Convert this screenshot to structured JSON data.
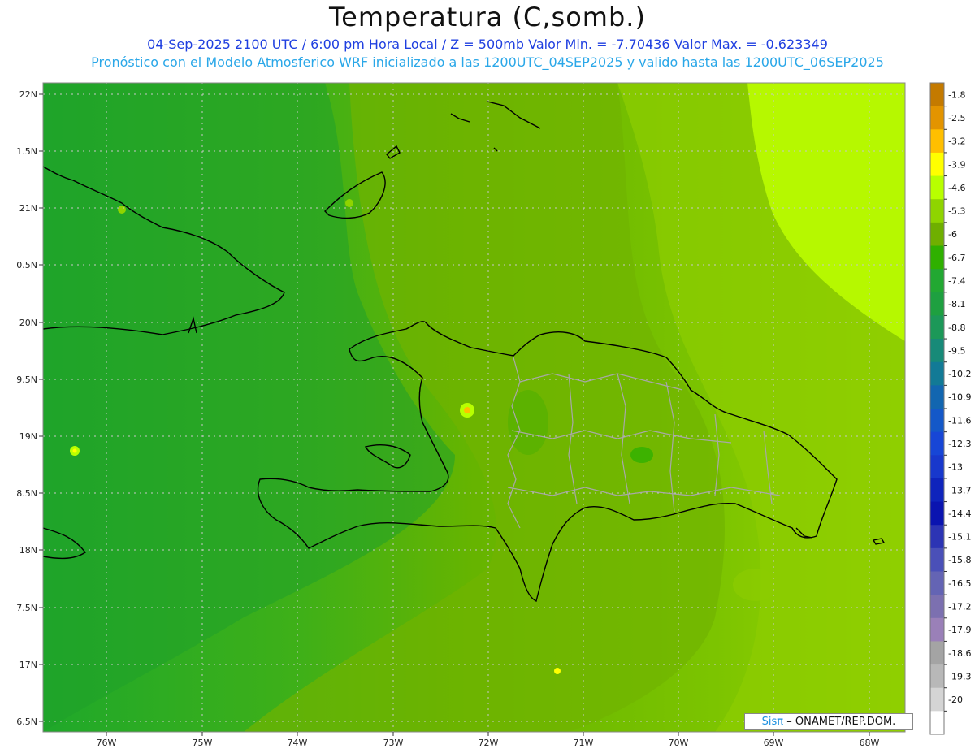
{
  "header": {
    "title": "Temperatura (C,somb.)",
    "subtitle1": "04-Sep-2025  2100 UTC / 6:00 pm Hora Local / Z = 500mb  Valor Min. = -7.70436  Valor Max. = -0.623349",
    "subtitle2": "Pronóstico con el Modelo Atmosferico WRF inicializado a las 1200UTC_04SEP2025 y valido hasta las  1200UTC_06SEP2025"
  },
  "axes": {
    "lat_labels": [
      "22N",
      "1.5N",
      "21N",
      "0.5N",
      "20N",
      "9.5N",
      "19N",
      "8.5N",
      "18N",
      "7.5N",
      "17N",
      "6.5N"
    ],
    "lon_labels": [
      "76W",
      "75W",
      "74W",
      "73W",
      "72W",
      "71W",
      "70W",
      "69W",
      "68W"
    ]
  },
  "colorbar": {
    "labels": [
      "-1.8",
      "-2.5",
      "-3.2",
      "-3.9",
      "-4.6",
      "-5.3",
      "-6",
      "-6.7",
      "-7.4",
      "-8.1",
      "-8.8",
      "-9.5",
      "-10.2",
      "-10.9",
      "-11.6",
      "-12.3",
      "-13",
      "-13.7",
      "-14.4",
      "-15.1",
      "-15.8",
      "-16.5",
      "-17.2",
      "-17.9",
      "-18.6",
      "-19.3",
      "-20"
    ],
    "colors": [
      "#c47a00",
      "#e39400",
      "#ffbf00",
      "#ffff00",
      "#b8ff00",
      "#8fd400",
      "#6faf00",
      "#2fb000",
      "#22a832",
      "#1ea040",
      "#1c9858",
      "#178a78",
      "#127a96",
      "#1266b0",
      "#1458c8",
      "#1746d6",
      "#1838cc",
      "#0f24bc",
      "#0a14b0",
      "#2c34b4",
      "#4a50b8",
      "#6464b4",
      "#7c70b0",
      "#9a80b8",
      "#a4a4a4",
      "#b8b8b8",
      "#d4d4d4",
      "#ffffff"
    ]
  },
  "map_colors": {
    "background_west": "#1fa82a",
    "mid": "#6fb800",
    "east": "#a2e200",
    "east_light": "#b8ff00",
    "coast": "#000000",
    "province_border": "#a8a8a8",
    "grid": "#bfbfbf"
  },
  "credit": {
    "brand": "Sisπ",
    "text": "– ONAMET/REP.DOM."
  }
}
